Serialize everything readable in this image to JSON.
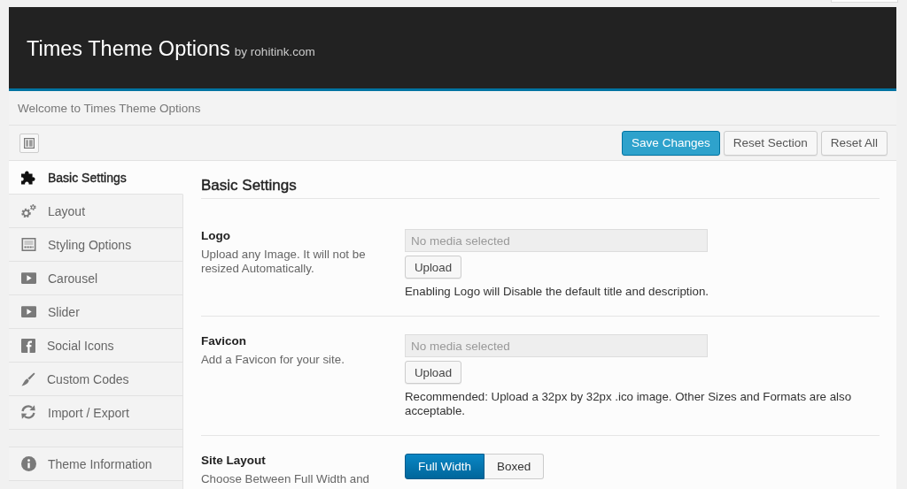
{
  "header": {
    "title": "Times Theme Options",
    "byline": "by rohitink.com"
  },
  "intro": {
    "text": "Welcome to Times Theme Options"
  },
  "toolbar": {
    "buttons": [
      {
        "label": "Save Changes",
        "kind": "primary"
      },
      {
        "label": "Reset Section",
        "kind": "default"
      },
      {
        "label": "Reset All",
        "kind": "default"
      }
    ]
  },
  "sidebar": {
    "groups": [
      {
        "items": [
          {
            "label": "Basic Settings",
            "selected": true
          },
          {
            "label": "Layout",
            "selected": false
          },
          {
            "label": "Styling Options",
            "selected": false
          },
          {
            "label": "Carousel",
            "selected": false
          },
          {
            "label": "Slider",
            "selected": false
          },
          {
            "label": "Social Icons",
            "selected": false
          },
          {
            "label": "Custom Codes",
            "selected": false
          },
          {
            "label": "Import / Export",
            "selected": false
          }
        ]
      },
      {
        "items": [
          {
            "label": "Theme Information",
            "selected": false
          }
        ]
      }
    ]
  },
  "content": {
    "heading": "Basic Settings",
    "sections": [
      {
        "kind": "media",
        "title": "Logo",
        "description": "Upload any Image. It will not be resized Automatically.",
        "field": {
          "placeholder": "No media selected"
        },
        "button": "Upload",
        "note": "Enabling Logo will Disable the default title and description."
      },
      {
        "kind": "media",
        "title": "Favicon",
        "description": "Add a Favicon for your site.",
        "field": {
          "placeholder": "No media selected"
        },
        "button": "Upload",
        "note": "Recommended: Upload a 32px by 32px .ico image. Other Sizes and Formats are also acceptable."
      },
      {
        "kind": "buttonset",
        "title": "Site Layout",
        "description": "Choose Between Full Width and",
        "options": [
          {
            "label": "Full Width",
            "selected": true
          },
          {
            "label": "Boxed",
            "selected": false
          }
        ]
      }
    ]
  }
}
